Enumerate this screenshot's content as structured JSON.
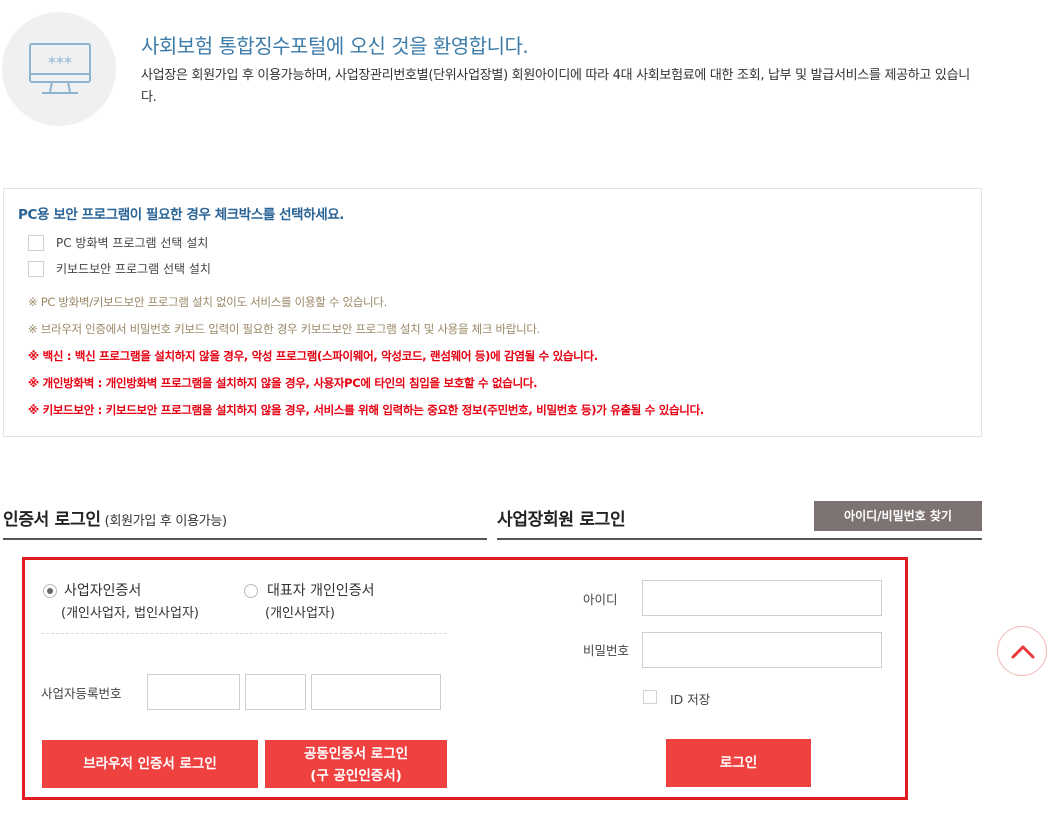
{
  "welcome": {
    "icon": "monitor-password-icon",
    "icon_text": "***",
    "title": "사회보험 통합징수포털에 오신 것을 환영합니다.",
    "description": "사업장은 회원가입 후 이용가능하며, 사업장관리번호별(단위사업장별) 회원아이디에 따라 4대 사회보험료에 대한 조회, 납부 및 발급서비스를 제공하고 있습니다."
  },
  "security": {
    "title": "PC용 보안 프로그램이 필요한 경우 체크박스를 선택하세요.",
    "options": [
      {
        "label": "PC 방화벽 프로그램 선택 설치",
        "checked": false
      },
      {
        "label": "키보드보안 프로그램 선택 설치",
        "checked": false
      }
    ],
    "notes_gray": [
      "※ PC 방화벽/키보드보안 프로그램 설치 없이도 서비스를 이용할 수 있습니다.",
      "※ 브라우저 인증에서 비밀번호 키보드 입력이 필요한 경우 키보드보안 프로그램 설치 및 사용을 체크 바랍니다."
    ],
    "notes_red": [
      "※ 백신 : 백신 프로그램을 설치하지 않을 경우, 악성 프로그램(스파이웨어, 악성코드, 랜섬웨어 등)에 감염될 수 있습니다.",
      "※ 개인방화벽 : 개인방화벽 프로그램을 설치하지 않을 경우, 사용자PC에 타인의 침입을 보호할 수 없습니다.",
      "※ 키보드보안 : 키보드보안 프로그램을 설치하지 않을 경우, 서비스를 위해 입력하는 중요한 정보(주민번호, 비밀번호 등)가 유출될 수 있습니다."
    ],
    "colors": {
      "title": "#2a6496",
      "note_gray": "#9a8866",
      "note_red": "#e60012"
    }
  },
  "cert_login": {
    "title": "인증서 로그인",
    "subtitle": "(회원가입 후 이용가능)",
    "radio_options": [
      {
        "label": "사업자인증서",
        "sub": "(개인사업자, 법인사업자)",
        "selected": true
      },
      {
        "label": "대표자 개인인증서",
        "sub": "(개인사업자)",
        "selected": false
      }
    ],
    "biz_number_label": "사업자등록번호",
    "biz_number_values": [
      "",
      "",
      ""
    ],
    "browser_cert_button": "브라우저 인증서 로그인",
    "joint_cert_button_line1": "공동인증서 로그인",
    "joint_cert_button_line2": "(구 공인인증서)"
  },
  "member_login": {
    "title": "사업장회원 로그인",
    "find_button": "아이디/비밀번호 찾기",
    "id_label": "아이디",
    "id_value": "",
    "password_label": "비밀번호",
    "password_value": "",
    "save_id_label": "ID 저장",
    "save_id_checked": false,
    "login_button": "로그인"
  },
  "scroll_top_icon": "chevron-up-icon",
  "colors": {
    "accent_red": "#f04141",
    "frame_red": "#e31b23",
    "find_button_bg": "#7d7372"
  }
}
